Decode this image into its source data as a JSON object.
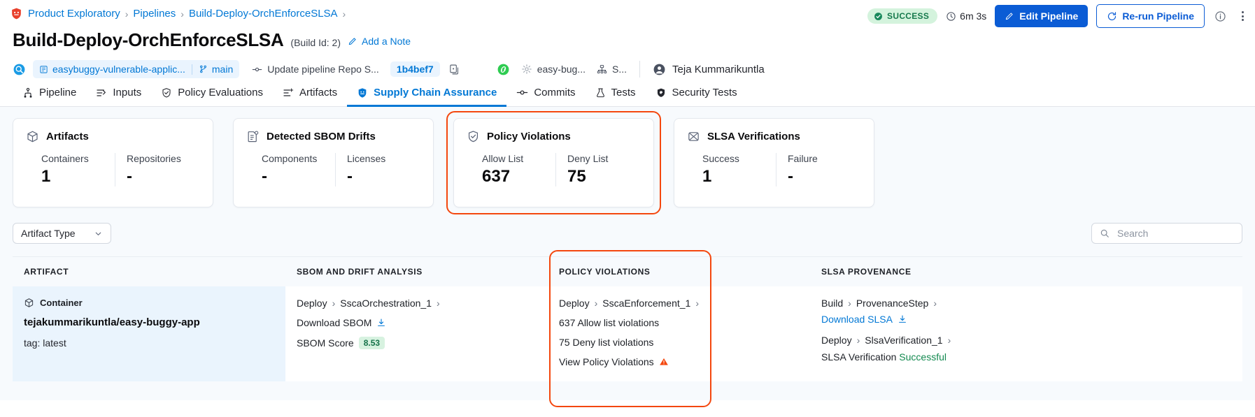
{
  "breadcrumb": {
    "icon": "shield-bug-icon",
    "items": [
      "Product Exploratory",
      "Pipelines",
      "Build-Deploy-OrchEnforceSLSA"
    ],
    "separator": "›"
  },
  "header": {
    "title": "Build-Deploy-OrchEnforceSLSA",
    "build_id": "(Build Id: 2)",
    "add_note": "Add a Note",
    "status": "SUCCESS",
    "duration": "6m 3s",
    "edit_pipeline": "Edit Pipeline",
    "rerun_pipeline": "Re-run Pipeline",
    "info_icon": "info-icon",
    "more_icon": "kebab-menu-icon"
  },
  "meta": {
    "repo": "easybuggy-vulnerable-applic...",
    "branch": "main",
    "commit_message": "Update pipeline Repo S...",
    "commit_sha": "1b4bef7",
    "copy_icon": "copy-icon",
    "service": "easy-bug...",
    "environment": "S...",
    "user": "Teja Kummarikuntla"
  },
  "tabs": [
    {
      "label": "Pipeline",
      "icon": "pipeline-icon",
      "active": false
    },
    {
      "label": "Inputs",
      "icon": "inputs-icon",
      "active": false
    },
    {
      "label": "Policy Evaluations",
      "icon": "policy-shield-icon",
      "active": false
    },
    {
      "label": "Artifacts",
      "icon": "artifacts-icon",
      "active": false
    },
    {
      "label": "Supply Chain Assurance",
      "icon": "supply-chain-shield-icon",
      "active": true
    },
    {
      "label": "Commits",
      "icon": "commit-icon",
      "active": false
    },
    {
      "label": "Tests",
      "icon": "flask-icon",
      "active": false
    },
    {
      "label": "Security Tests",
      "icon": "security-shield-icon",
      "active": false
    }
  ],
  "cards": [
    {
      "title": "Artifacts",
      "icon": "cube-icon",
      "highlighted": false,
      "columns": [
        {
          "label": "Containers",
          "value": "1"
        },
        {
          "label": "Repositories",
          "value": "-"
        }
      ]
    },
    {
      "title": "Detected SBOM Drifts",
      "icon": "sbom-drift-icon",
      "highlighted": false,
      "columns": [
        {
          "label": "Components",
          "value": "-"
        },
        {
          "label": "Licenses",
          "value": "-"
        }
      ]
    },
    {
      "title": "Policy Violations",
      "icon": "policy-check-shield-icon",
      "highlighted": true,
      "columns": [
        {
          "label": "Allow List",
          "value": "637"
        },
        {
          "label": "Deny List",
          "value": "75"
        }
      ]
    },
    {
      "title": "SLSA Verifications",
      "icon": "slsa-icon",
      "highlighted": false,
      "columns": [
        {
          "label": "Success",
          "value": "1"
        },
        {
          "label": "Failure",
          "value": "-"
        }
      ]
    }
  ],
  "filters": {
    "artifact_type_label": "Artifact Type",
    "chevron_icon": "chevron-down-icon",
    "search_placeholder": "Search",
    "search_value": "",
    "search_icon": "search-icon"
  },
  "table": {
    "headers": {
      "artifact": "ARTIFACT",
      "sbom": "SBOM AND DRIFT ANALYSIS",
      "policy": "POLICY VIOLATIONS",
      "slsa": "SLSA PROVENANCE"
    },
    "policy_highlighted": true,
    "row": {
      "artifact": {
        "type_icon": "cube-icon",
        "type": "Container",
        "name": "tejakummarikuntla/easy-buggy-app",
        "tag": "tag: latest"
      },
      "sbom": {
        "crumb": [
          "Deploy",
          "SscaOrchestration_1"
        ],
        "download_label": "Download SBOM",
        "download_icon": "download-icon",
        "score_label": "SBOM Score",
        "score_value": "8.53"
      },
      "policy": {
        "crumb": [
          "Deploy",
          "SscaEnforcement_1"
        ],
        "allow_violations": "637 Allow list violations",
        "deny_violations": "75 Deny list violations",
        "view_link": "View Policy Violations",
        "warning_icon": "warning-triangle-icon"
      },
      "slsa": {
        "crumb1": [
          "Build",
          "ProvenanceStep"
        ],
        "download_label": "Download SLSA",
        "download_icon": "download-icon",
        "crumb2": [
          "Deploy",
          "SlsaVerification_1"
        ],
        "verification_label": "SLSA Verification",
        "verification_status": "Successful"
      }
    }
  },
  "colors": {
    "accent": "#0278d5",
    "primary_button": "#0b5cd5",
    "highlight_ring": "#f4470e",
    "success_text": "#12894f",
    "success_pill_bg": "#d4f3dd",
    "row_bg": "#eaf4fd"
  }
}
